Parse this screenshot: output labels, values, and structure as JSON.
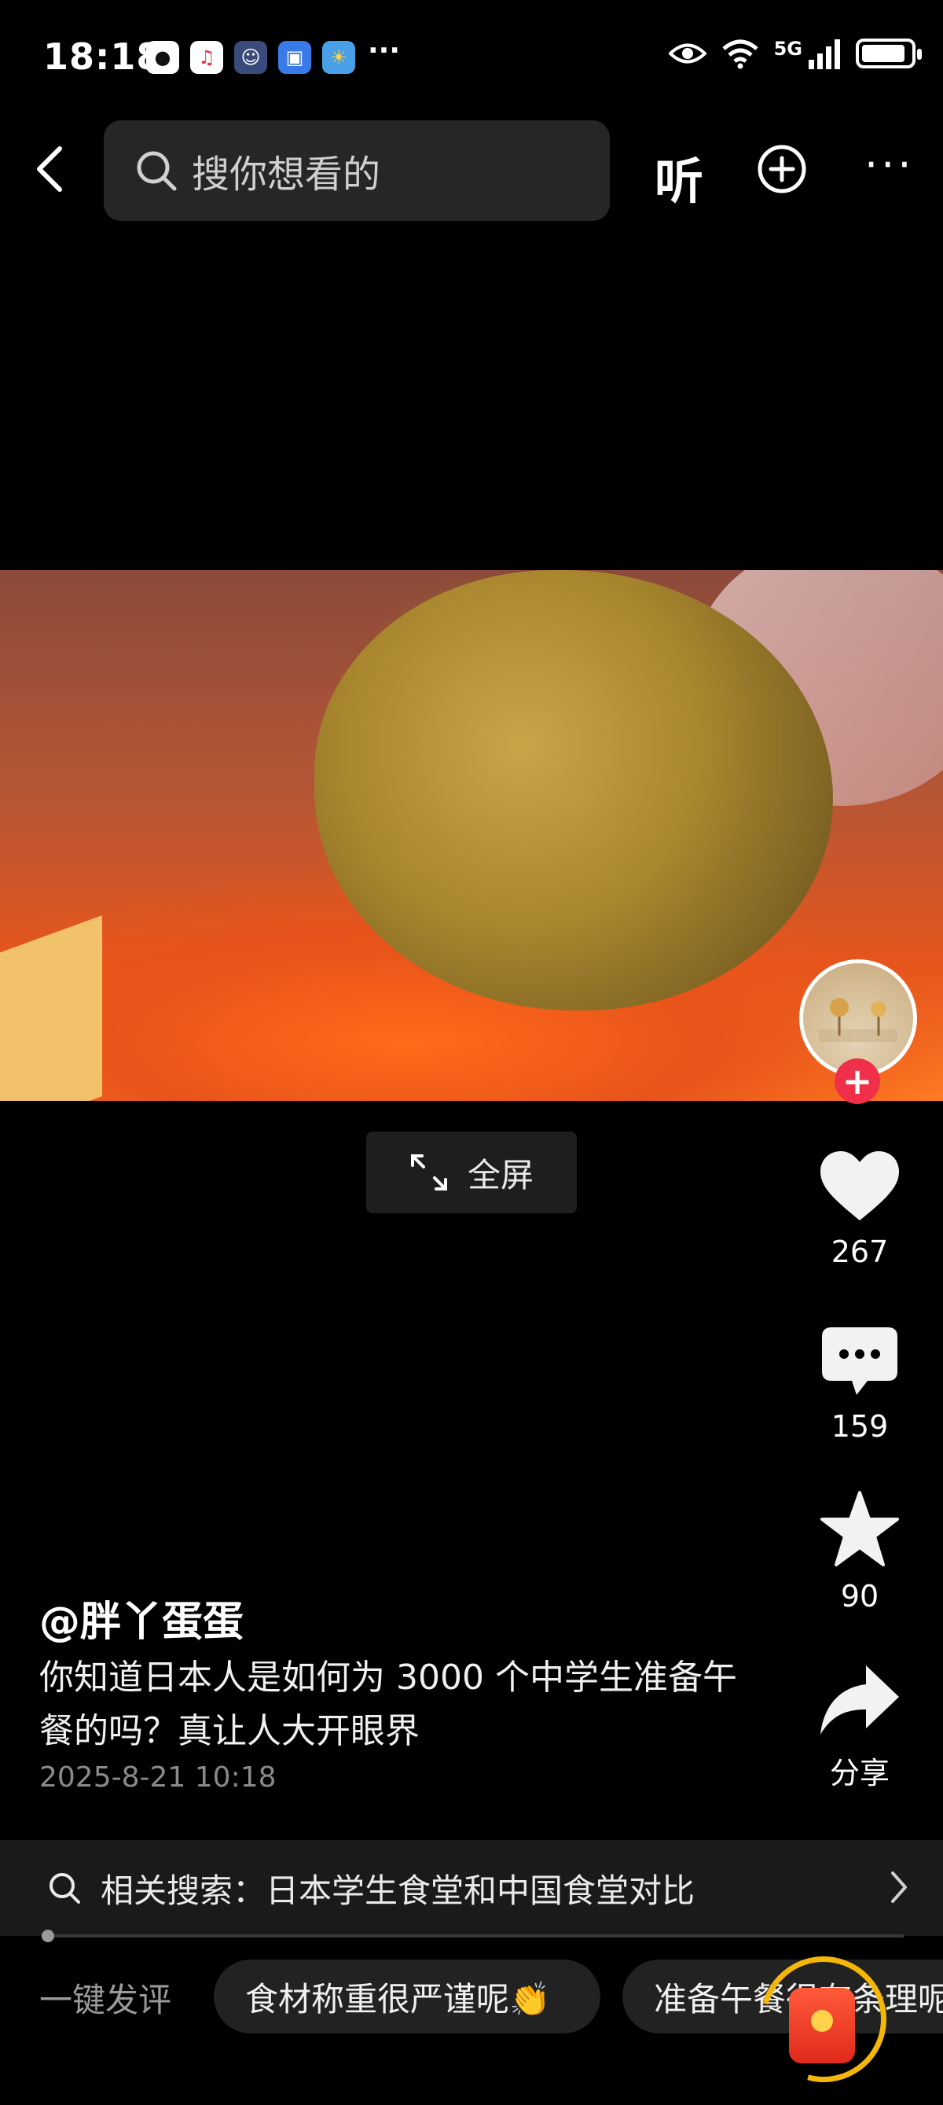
{
  "status_bar": {
    "time": "18:18",
    "network": "5G",
    "notification_icons": [
      "wechat-icon",
      "music-icon",
      "robot-app-icon",
      "card-app-icon",
      "weather-icon"
    ],
    "more": "···"
  },
  "top_nav": {
    "search_placeholder": "搜你想看的",
    "listen_label": "听",
    "more_label": "···"
  },
  "video": {
    "fullscreen_label": "全屏"
  },
  "actions": {
    "like_count": "267",
    "comment_count": "159",
    "favorite_count": "90",
    "share_label": "分享"
  },
  "post": {
    "author": "@胖丫蛋蛋",
    "description": "你知道日本人是如何为 3000 个中学生准备午餐的吗？真让人大开眼界",
    "date": "2025-8-21 10:18"
  },
  "related_search": {
    "label": "相关搜索：日本学生食堂和中国食堂对比"
  },
  "playback": {
    "progress_fraction": 0.006
  },
  "bottom_bar": {
    "quick_comment_label": "一键发评",
    "chips": [
      "食材称重很严谨呢👏",
      "准备午餐很有条理呢"
    ]
  },
  "colors": {
    "background": "#000000",
    "accent_red": "#f0304a",
    "ring_yellow": "#f5b60a"
  }
}
